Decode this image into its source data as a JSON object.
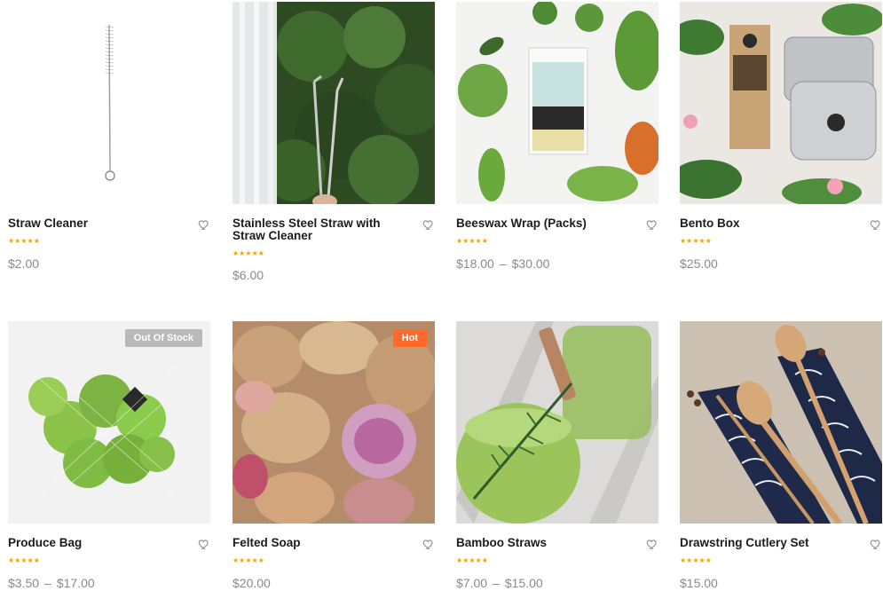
{
  "colors": {
    "star": "#f0a500",
    "out_of_stock_badge": "#b9b9b9",
    "hot_badge": "#ff6a2c"
  },
  "products": [
    {
      "title": "Straw Cleaner",
      "rating": 5,
      "price": "$2.00",
      "price_max": "",
      "badge": "",
      "heart_icon": "heart-outline-icon"
    },
    {
      "title": "Stainless Steel Straw with Straw Cleaner",
      "rating": 5,
      "price": "$6.00",
      "price_max": "",
      "badge": "",
      "heart_icon": "heart-outline-icon"
    },
    {
      "title": "Beeswax Wrap (Packs)",
      "rating": 5,
      "price": "$18.00",
      "price_max": "$30.00",
      "badge": "",
      "heart_icon": "heart-outline-icon"
    },
    {
      "title": "Bento Box",
      "rating": 5,
      "price": "$25.00",
      "price_max": "",
      "badge": "",
      "heart_icon": "heart-outline-icon"
    },
    {
      "title": "Produce Bag",
      "rating": 5,
      "price": "$3.50",
      "price_max": "$17.00",
      "badge": "Out Of Stock",
      "heart_icon": "heart-outline-icon"
    },
    {
      "title": "Felted Soap",
      "rating": 5,
      "price": "$20.00",
      "price_max": "",
      "badge": "Hot",
      "heart_icon": "heart-outline-icon"
    },
    {
      "title": "Bamboo Straws",
      "rating": 5,
      "price": "$7.00",
      "price_max": "$15.00",
      "badge": "",
      "heart_icon": "heart-outline-icon"
    },
    {
      "title": "Drawstring Cutlery Set",
      "rating": 5,
      "price": "$15.00",
      "price_max": "",
      "badge": "",
      "heart_icon": "heart-outline-icon"
    }
  ],
  "price_range_separator": "–",
  "star_glyph": "★★★★★"
}
